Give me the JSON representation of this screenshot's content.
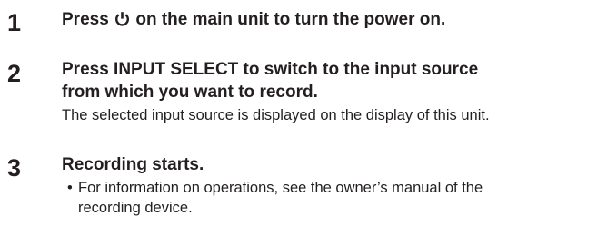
{
  "steps": [
    {
      "number": "1",
      "heading_before": "Press",
      "heading_icon": "power-icon",
      "heading_after": "on the main unit to turn the power on."
    },
    {
      "number": "2",
      "heading_line1": "Press INPUT SELECT to switch to the input source",
      "heading_line2": "from which you want to record.",
      "body": "The selected input source is displayed on the display of this unit."
    },
    {
      "number": "3",
      "heading": "Recording starts.",
      "bullets": [
        {
          "line1": "For information on operations, see the owner’s manual of the",
          "line2": "recording device."
        }
      ]
    }
  ]
}
